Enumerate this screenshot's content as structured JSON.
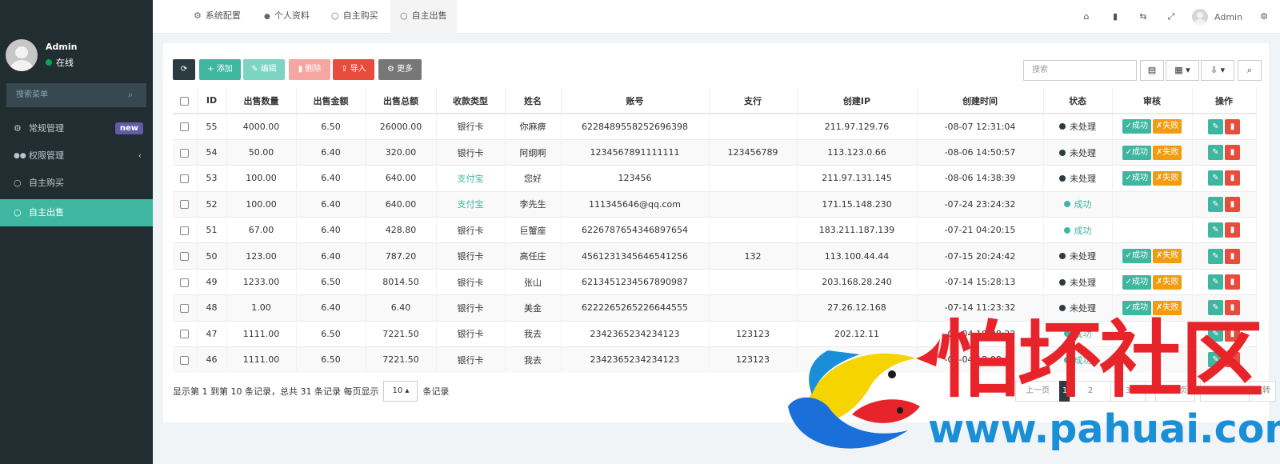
{
  "topbar": {
    "tabs": [
      {
        "icon": "⚙",
        "label": "系统配置"
      },
      {
        "icon": "👤",
        "label": "个人资料"
      },
      {
        "icon": "○",
        "label": "自主购买"
      },
      {
        "icon": "○",
        "label": "自主出售"
      }
    ],
    "user_name": "Admin"
  },
  "sidebar": {
    "user_name": "Admin",
    "status": "在线",
    "search_placeholder": "搜索菜单",
    "items": [
      {
        "icon": "⚙",
        "label": "常规管理",
        "badge": "new"
      },
      {
        "icon": "👥",
        "label": "权限管理",
        "chevron": "‹"
      },
      {
        "icon": "○",
        "label": "自主购买"
      },
      {
        "icon": "○",
        "label": "自主出售"
      }
    ]
  },
  "toolbar": {
    "refresh": "⟳",
    "add": "添加",
    "edit": "编辑",
    "delete": "删除",
    "import": "导入",
    "more": "更多",
    "search_placeholder": "搜索"
  },
  "table": {
    "headers": [
      "ID",
      "出售数量",
      "出售金额",
      "出售总额",
      "收款类型",
      "姓名",
      "账号",
      "支行",
      "创建IP",
      "创建时间",
      "状态",
      "审核",
      "操作"
    ],
    "rows": [
      {
        "id": "55",
        "qty": "4000.00",
        "price": "6.50",
        "total": "26000.00",
        "pay": "银行卡",
        "name": "你麻痹",
        "account": "6228489558252696398",
        "branch": "",
        "ip": "211.97.129.76",
        "time": "-08-07 12:31:04",
        "status": "未处理"
      },
      {
        "id": "54",
        "qty": "50.00",
        "price": "6.40",
        "total": "320.00",
        "pay": "银行卡",
        "name": "阿纲啊",
        "account": "1234567891111111",
        "branch": "123456789",
        "ip": "113.123.0.66",
        "time": "-08-06 14:50:57",
        "status": "未处理"
      },
      {
        "id": "53",
        "qty": "100.00",
        "price": "6.40",
        "total": "640.00",
        "pay": "支付宝",
        "name": "您好",
        "account": "123456",
        "branch": "",
        "ip": "211.97.131.145",
        "time": "-08-06 14:38:39",
        "status": "未处理"
      },
      {
        "id": "52",
        "qty": "100.00",
        "price": "6.40",
        "total": "640.00",
        "pay": "支付宝",
        "name": "李先生",
        "account": "111345646@qq.com",
        "branch": "",
        "ip": "171.15.148.230",
        "time": "-07-24 23:24:32",
        "status": "成功"
      },
      {
        "id": "51",
        "qty": "67.00",
        "price": "6.40",
        "total": "428.80",
        "pay": "银行卡",
        "name": "巨蟹座",
        "account": "6226787654346897654",
        "branch": "",
        "ip": "183.211.187.139",
        "time": "-07-21 04:20:15",
        "status": "成功"
      },
      {
        "id": "50",
        "qty": "123.00",
        "price": "6.40",
        "total": "787.20",
        "pay": "银行卡",
        "name": "高任庄",
        "account": "4561231345646541256",
        "branch": "132",
        "ip": "113.100.44.44",
        "time": "-07-15 20:24:42",
        "status": "未处理"
      },
      {
        "id": "49",
        "qty": "1233.00",
        "price": "6.50",
        "total": "8014.50",
        "pay": "银行卡",
        "name": "张山",
        "account": "6213451234567890987",
        "branch": "",
        "ip": "203.168.28.240",
        "time": "-07-14 15:28:13",
        "status": "未处理"
      },
      {
        "id": "48",
        "qty": "1.00",
        "price": "6.40",
        "total": "6.40",
        "pay": "银行卡",
        "name": "美金",
        "account": "6222265265226644555",
        "branch": "",
        "ip": "27.26.12.168",
        "time": "-07-14 11:23:32",
        "status": "未处理"
      },
      {
        "id": "47",
        "qty": "1111.00",
        "price": "6.50",
        "total": "7221.50",
        "pay": "银行卡",
        "name": "我去",
        "account": "2342365234234123",
        "branch": "123123",
        "ip": "202.12.11",
        "time": "-07-04 18:08:22",
        "status": "成功"
      },
      {
        "id": "46",
        "qty": "1111.00",
        "price": "6.50",
        "total": "7221.50",
        "pay": "银行卡",
        "name": "我去",
        "account": "2342365234234123",
        "branch": "123123",
        "ip": "",
        "time": "-07-04 18:08:12",
        "status": "成功"
      }
    ],
    "approve_label": "成功",
    "reject_label": "失败"
  },
  "pagination": {
    "info_prefix": "显示第 1 到第 10 条记录，总共 31 条记录 每页显示",
    "per_page": "10",
    "info_suffix": "条记录",
    "prev": "上一页",
    "pages": [
      "1",
      "2",
      "3",
      "4"
    ],
    "next": "下一页",
    "jump": "跳转"
  },
  "watermark": {
    "text": "怕坏社区",
    "url": "www.pahuai.com"
  },
  "colors": {
    "sidebar_bg": "#222d32",
    "accent": "#3fb7a0",
    "warning": "#f39c12",
    "danger": "#e74c3c",
    "dark": "#2c3b41"
  }
}
